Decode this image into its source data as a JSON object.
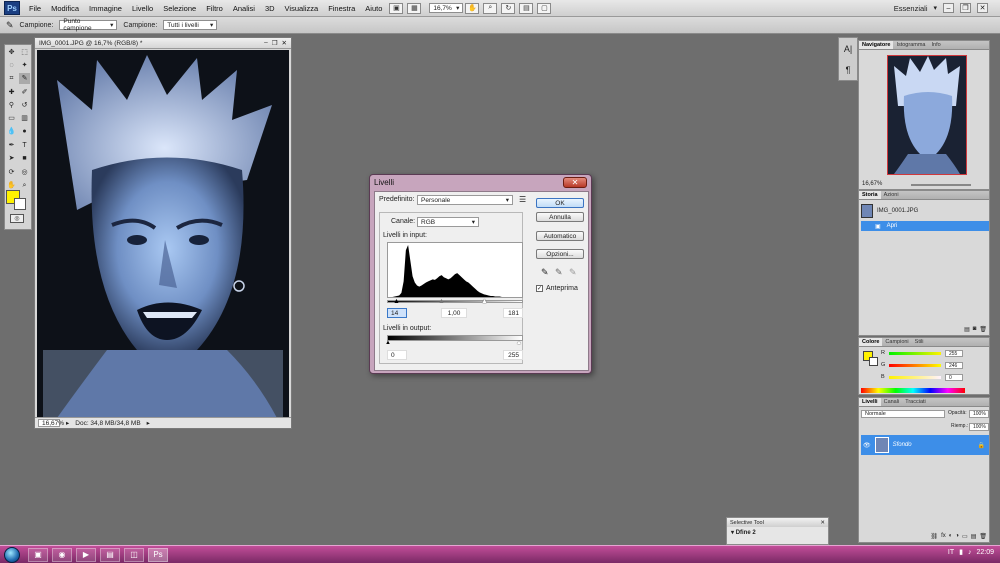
{
  "app": {
    "logo": "Ps",
    "menus": [
      "File",
      "Modifica",
      "Immagine",
      "Livello",
      "Selezione",
      "Filtro",
      "Analisi",
      "3D",
      "Visualizza",
      "Finestra",
      "Aiuto"
    ],
    "zoom_field": "16,7%",
    "workspace": "Essenziali"
  },
  "options_bar": {
    "sample_label": "Campione:",
    "sample_value": "Punto campione",
    "sample2_label": "Campione:",
    "sample2_value": "Tutti i livelli"
  },
  "document": {
    "title": "IMG_0001.JPG @ 16,7% (RGB/8) *",
    "zoom": "16,67%",
    "doc_info": "Doc: 34,8 MB/34,8 MB"
  },
  "levels_dialog": {
    "title": "Livelli",
    "close": "✕",
    "preset_label": "Predefinito:",
    "preset_value": "Personale",
    "channel_label": "Canale:",
    "channel_value": "RGB",
    "input_label": "Livelli in input:",
    "input_black": "14",
    "input_gamma": "1,00",
    "input_white": "181",
    "output_label": "Livelli in output:",
    "output_black": "0",
    "output_white": "255",
    "ok": "OK",
    "cancel": "Annulla",
    "auto": "Automatico",
    "options": "Opzioni...",
    "preview": "Anteprima",
    "histogram": [
      0,
      0,
      0,
      1,
      2,
      3,
      8,
      30,
      90,
      100,
      70,
      40,
      28,
      22,
      20,
      22,
      25,
      28,
      30,
      32,
      34,
      33,
      36,
      40,
      42,
      38,
      36,
      34,
      36,
      40,
      44,
      46,
      42,
      38,
      34,
      30,
      28,
      24,
      20,
      16,
      12,
      9,
      7,
      5,
      4,
      3,
      2,
      2,
      1,
      1,
      1,
      0,
      0,
      0,
      0,
      0,
      0,
      0,
      0,
      0
    ]
  },
  "navigator": {
    "tabs": [
      "Navigatore",
      "Istogramma",
      "Info"
    ],
    "zoom": "16,67%"
  },
  "history": {
    "tabs": [
      "Storia",
      "Azioni"
    ],
    "snapshot": "IMG_0001.JPG",
    "step": "Apri"
  },
  "color_panel": {
    "tabs": [
      "Colore",
      "Campioni",
      "Stili"
    ],
    "r_label": "R",
    "g_label": "G",
    "b_label": "B",
    "r_value": "255",
    "g_value": "246",
    "b_value": "0",
    "fg_color": "#fff200"
  },
  "layers": {
    "tabs": [
      "Livelli",
      "Canali",
      "Tracciati"
    ],
    "blend": "Normale",
    "opacity_label": "Opacità:",
    "opacity": "100%",
    "fill_label": "Riemp.:",
    "fill": "100%",
    "layer_name": "Sfondo"
  },
  "selective_tool": {
    "title": "Selective Tool",
    "item": "Dfine 2"
  },
  "taskbar": {
    "lang": "IT",
    "time": "22:09"
  }
}
